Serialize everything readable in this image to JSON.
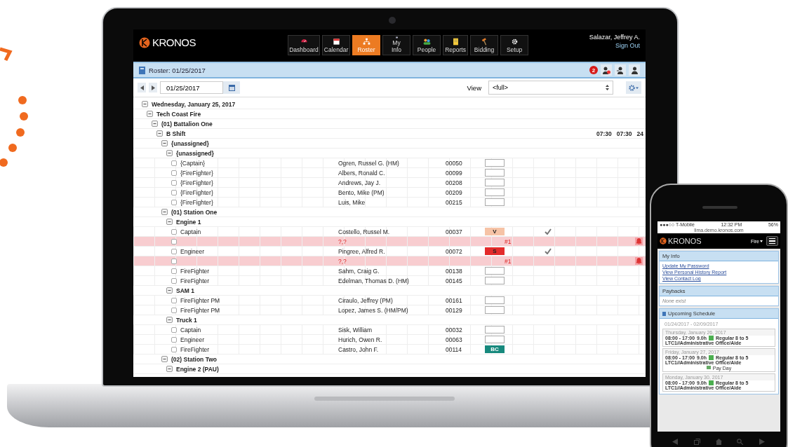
{
  "app": {
    "logo": "KRONOS",
    "nav": [
      {
        "label": "Dashboard",
        "selected": false
      },
      {
        "label": "Calendar",
        "selected": false
      },
      {
        "label": "Roster",
        "selected": true
      },
      {
        "label": "My Info",
        "selected": false
      },
      {
        "label": "People",
        "selected": false
      },
      {
        "label": "Reports",
        "selected": false
      },
      {
        "label": "Bidding",
        "selected": false
      },
      {
        "label": "Setup",
        "selected": false
      }
    ],
    "user": {
      "name": "Salazar, Jeffrey A.",
      "sign_out": "Sign Out"
    },
    "roster_bar": {
      "title": "Roster: 01/25/2017",
      "badge": "2"
    },
    "toolbar": {
      "date": "01/25/2017",
      "view_label": "View",
      "view": "<full>"
    },
    "tree": [
      {
        "kind": "group",
        "label": "Wednesday, January 25, 2017",
        "expanded": true,
        "children": [
          {
            "kind": "group",
            "label": "Tech Coast Fire",
            "expanded": true,
            "children": [
              {
                "kind": "group",
                "label": "(01) Battalion One",
                "expanded": true,
                "children": [
                  {
                    "kind": "group",
                    "label": "B Shift",
                    "expanded": true,
                    "times": [
                      "07:30",
                      "07:30",
                      "24"
                    ],
                    "children": [
                      {
                        "kind": "group",
                        "label": "{unassigned}",
                        "expanded": true,
                        "children": [
                          {
                            "kind": "group",
                            "label": "{unassigned}",
                            "expanded": true,
                            "children": [
                              {
                                "kind": "person",
                                "role": "{Captain}",
                                "name": "Ogren, Russel G. (HM)",
                                "number": "00050",
                                "checked": false,
                                "approved": false
                              },
                              {
                                "kind": "person",
                                "role": "{FireFighter}",
                                "name": "Albers, Ronald C.",
                                "number": "00099",
                                "checked": false,
                                "approved": false
                              },
                              {
                                "kind": "person",
                                "role": "{FireFighter}",
                                "name": "Andrews, Jay J.",
                                "number": "00208",
                                "checked": false,
                                "approved": false
                              },
                              {
                                "kind": "person",
                                "role": "{FireFighter}",
                                "name": "Bento, Mike (PM)",
                                "number": "00209",
                                "checked": false,
                                "approved": false
                              },
                              {
                                "kind": "person",
                                "role": "{FireFighter}",
                                "name": "Luis, Mike",
                                "number": "00215",
                                "checked": false,
                                "approved": false
                              }
                            ]
                          }
                        ]
                      },
                      {
                        "kind": "group",
                        "label": "(01) Station One",
                        "expanded": true,
                        "children": [
                          {
                            "kind": "group",
                            "label": "Engine 1",
                            "expanded": true,
                            "children": [
                              {
                                "kind": "person",
                                "role": "Captain",
                                "name": "Costello, Russel M.",
                                "number": "00037",
                                "code": "V",
                                "color": "#f6c3a6",
                                "checked": false,
                                "approved": true
                              },
                              {
                                "kind": "alert",
                                "name": "?,?",
                                "note": "#1",
                                "checked": false
                              },
                              {
                                "kind": "person",
                                "role": "Engineer",
                                "name": "Pingree, Alfred R.",
                                "number": "00072",
                                "code": "S",
                                "color": "#e32b2b",
                                "checked": false,
                                "approved": true
                              },
                              {
                                "kind": "alert",
                                "name": "?,?",
                                "note": "#1",
                                "checked": false
                              },
                              {
                                "kind": "person",
                                "role": "FireFighter",
                                "name": "Sahm, Craig G.",
                                "number": "00138",
                                "checked": false,
                                "approved": false
                              },
                              {
                                "kind": "person",
                                "role": "FireFighter",
                                "name": "Edelman, Thomas D. (HM)",
                                "number": "00145",
                                "checked": false,
                                "approved": false
                              }
                            ]
                          },
                          {
                            "kind": "group",
                            "label": "SAM 1",
                            "expanded": true,
                            "children": [
                              {
                                "kind": "person",
                                "role": "FireFighter PM",
                                "name": "Ciraulo, Jeffrey (PM)",
                                "number": "00161",
                                "checked": false,
                                "approved": false
                              },
                              {
                                "kind": "person",
                                "role": "FireFighter PM",
                                "name": "Lopez, James S. (HM/PM)",
                                "number": "00129",
                                "checked": false,
                                "approved": false
                              }
                            ]
                          },
                          {
                            "kind": "group",
                            "label": "Truck 1",
                            "expanded": true,
                            "children": [
                              {
                                "kind": "person",
                                "role": "Captain",
                                "name": "Sisk, William",
                                "number": "00032",
                                "checked": false,
                                "approved": false
                              },
                              {
                                "kind": "person",
                                "role": "Engineer",
                                "name": "Hurich, Owen R.",
                                "number": "00063",
                                "checked": false,
                                "approved": false
                              },
                              {
                                "kind": "person",
                                "role": "FireFighter",
                                "name": "Castro, John F.",
                                "number": "00114",
                                "code": "BC",
                                "color": "#17897d",
                                "checked": false,
                                "approved": false
                              }
                            ]
                          }
                        ]
                      },
                      {
                        "kind": "group",
                        "label": "(02) Station Two",
                        "expanded": true,
                        "children": [
                          {
                            "kind": "group",
                            "label": "Engine 2 (PAU)",
                            "expanded": true
                          }
                        ]
                      }
                    ]
                  }
                ]
              }
            ]
          }
        ]
      }
    ]
  },
  "phone": {
    "status_bar": {
      "carrier": "●●●○○ T-Mobile",
      "time": "12:32 PM",
      "battery": "56%"
    },
    "url": "lima.demo.kronos.com",
    "logo": "KRONOS",
    "org": "Fire",
    "my_info": {
      "title": "My Info",
      "links": [
        "Update My Password",
        "View Personal History Report",
        "View Contact Log"
      ]
    },
    "paybacks": {
      "title": "Paybacks",
      "text": "None exist"
    },
    "schedule": {
      "title": "Upcoming Schedule",
      "range": "01/24/2017 - 02/09/2017",
      "days": [
        {
          "date": "Thursday, January 26, 2017",
          "time": "08:00 - 17:00",
          "hours": "9.0h",
          "pay_code": "Regular 8 to 5",
          "location": "LTC1//Administrative Office/Aide"
        },
        {
          "date": "Friday, January 27, 2017",
          "time": "08:00 - 17:00",
          "hours": "9.0h",
          "pay_code": "Regular 8 to 5",
          "location": "LTC1//Administrative Office/Aide",
          "note": "Pay Day"
        },
        {
          "date": "Monday, January 30, 2017",
          "time": "08:00 - 17:00",
          "hours": "9.0h",
          "pay_code": "Regular 8 to 5",
          "location": "LTC1//Administrative Office/Aide"
        }
      ]
    }
  }
}
